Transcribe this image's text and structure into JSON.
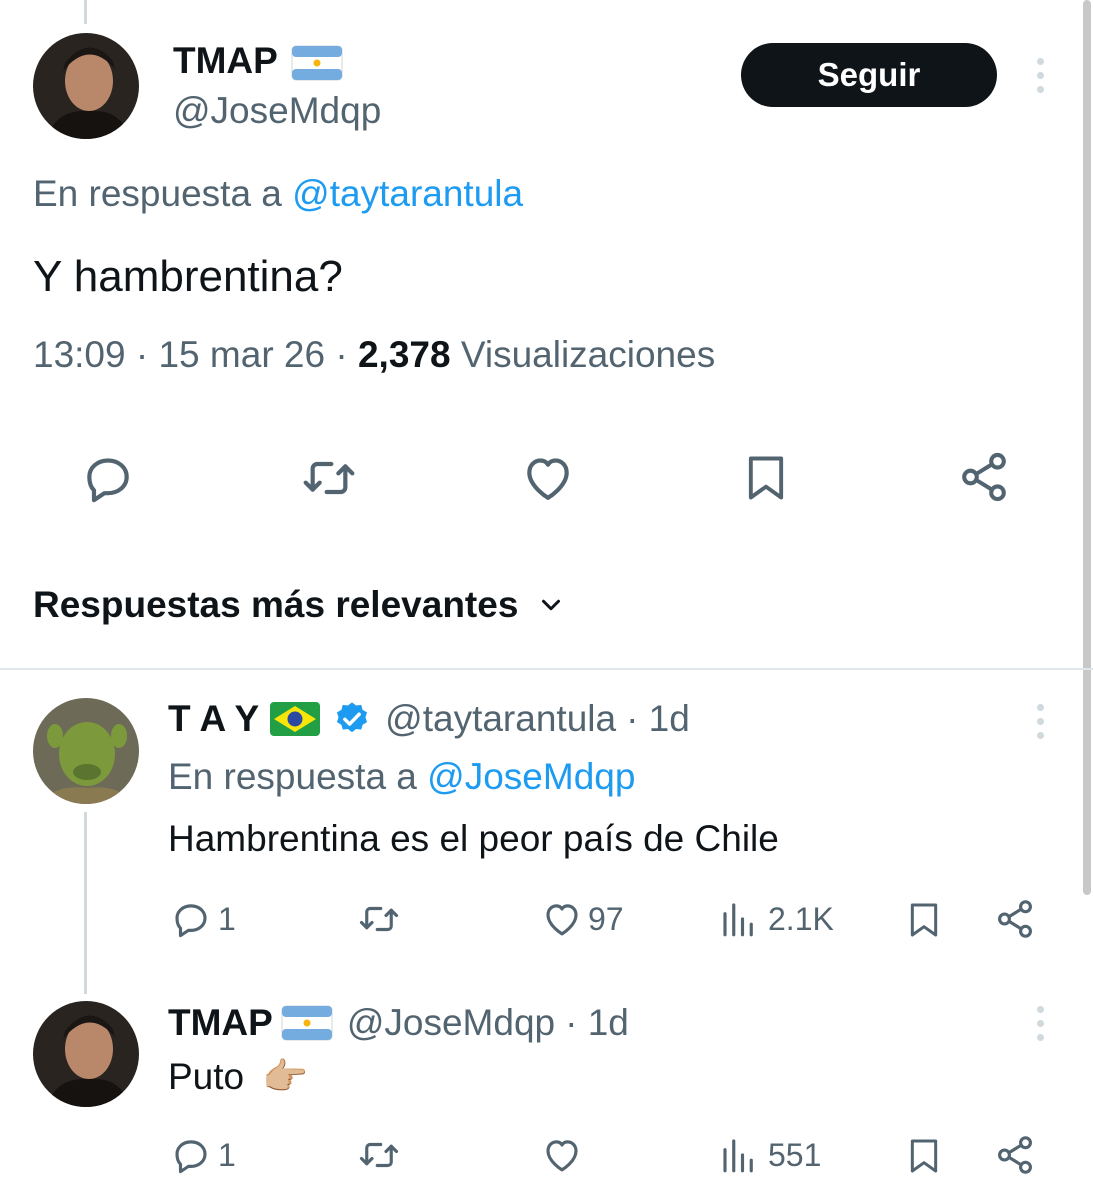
{
  "main_tweet": {
    "display_name": "TMAP",
    "handle": "@JoseMdqp",
    "follow_label": "Seguir",
    "reply_prefix": "En respuesta a",
    "reply_to": "@taytarantula",
    "text": "Y hambrentina?",
    "time": "13:09",
    "sep1": "·",
    "date": "15 mar 26",
    "sep2": "·",
    "views_count": "2,378",
    "views_label": "Visualizaciones"
  },
  "sort": {
    "label": "Respuestas más relevantes"
  },
  "replies": [
    {
      "display_name": "T A Y",
      "handle": "@taytarantula",
      "age": "· 1d",
      "reply_prefix": "En respuesta a",
      "reply_to": "@JoseMdqp",
      "text": "Hambrentina es el peor país de Chile",
      "reply_count": "1",
      "like_count": "97",
      "view_count": "2.1K"
    },
    {
      "display_name": "TMAP",
      "handle": "@JoseMdqp",
      "age": "· 1d",
      "text": "Puto",
      "emoji": "👉🏼",
      "reply_count": "1",
      "view_count": "551"
    }
  ],
  "colors": {
    "accent": "#1d9bf0",
    "secondary_text": "#536471",
    "primary_text": "#0f1419",
    "divider": "#e1e6ea"
  },
  "icons": [
    "reply-icon",
    "retweet-icon",
    "like-icon",
    "bookmark-icon",
    "share-icon",
    "views-icon",
    "verified-badge-icon",
    "chevron-down-icon",
    "more-options-icon",
    "argentina-flag-icon",
    "brazil-flag-icon"
  ]
}
